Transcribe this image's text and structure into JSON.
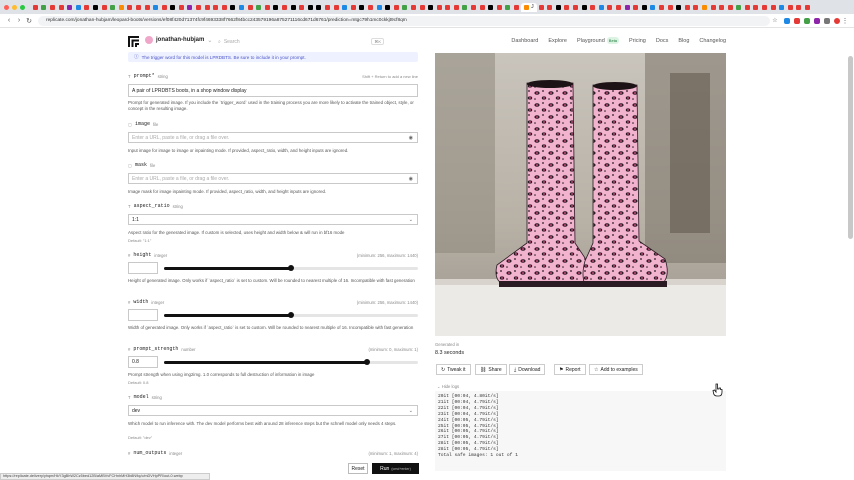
{
  "browser": {
    "url": "replicate.com/jonathan-hubjam/leopard-boots/versions/ef08f420d71374fc9f4693338f7662f84bcc243579196a875271116cd671d6761/prediction=mtgc79h1mc0ckkjt9cf8qm",
    "tab_colors": [
      "#e53935",
      "#43a047",
      "#e53935",
      "#e53935",
      "#8e24aa",
      "#1e88e5",
      "#e53935",
      "#000000",
      "#e53935",
      "#43a047",
      "#fb8c00",
      "#e53935",
      "#e53935",
      "#e53935",
      "#1e88e5",
      "#e53935",
      "#000000",
      "#e53935",
      "#8e24aa",
      "#e53935",
      "#e53935",
      "#e53935",
      "#e53935",
      "#000000",
      "#1e88e5",
      "#e53935",
      "#43a047",
      "#e53935",
      "#000000",
      "#e53935",
      "#000000",
      "#e53935",
      "#000000",
      "#000000",
      "#e53935",
      "#e53935",
      "#1e88e5",
      "#e53935",
      "#000000",
      "#e53935",
      "#1e88e5",
      "#000000",
      "#e53935",
      "#43a047",
      "#e53935",
      "#e53935",
      "#000000",
      "#e53935",
      "#e53935",
      "#e53935",
      "#43a047",
      "#e53935",
      "#e53935",
      "#000000",
      "#e53935",
      "#43a047",
      "#e53935",
      "#fb8c00",
      "#e53935",
      "#e53935",
      "#000000",
      "#e53935",
      "#e53935",
      "#000000",
      "#e53935",
      "#1e88e5",
      "#e53935",
      "#e53935",
      "#8e24aa",
      "#e53935",
      "#000000",
      "#1e88e5",
      "#e53935",
      "#e53935",
      "#000000",
      "#e53935",
      "#e53935",
      "#fb8c00",
      "#e53935",
      "#e53935",
      "#e53935",
      "#43a047",
      "#e53935",
      "#e53935",
      "#e53935",
      "#e53935",
      "#1e88e5",
      "#e53935",
      "#e53935",
      "#e53935"
    ],
    "active_tab_label": "J",
    "status_url": "https://replicate.delivery/yhqm/HkY3gBhW2Cz5bed12B/aMBVvFCHnhMH3b8N9q/c/mDVHpPR/out-0.webp"
  },
  "site": {
    "user": "jonathan-hubjam",
    "search_placeholder": "Search",
    "search_kbd": "⌘K",
    "nav": [
      "Dashboard",
      "Explore",
      "Playground",
      "Pricing",
      "Docs",
      "Blog",
      "Changelog"
    ],
    "playground_badge": "Beta"
  },
  "form": {
    "trigger_note": "The trigger word for this model is LPRDBTS. Be sure to include it in your prompt.",
    "prompt": {
      "name": "prompt*",
      "type": "string",
      "hint": "Shift + Return to add a new line",
      "value": "A pair of LPRDBTS boots, in a shop window display",
      "help": "Prompt for generated image. If you include the `trigger_word` used in the training process you are more likely to activate the trained object, style, or concept in the resulting image."
    },
    "image": {
      "name": "image",
      "type": "file",
      "placeholder": "Enter a URL, paste a file, or drag a file over.",
      "help": "Input image for image to image or inpainting mode. If provided, aspect_ratio, width, and height inputs are ignored."
    },
    "mask": {
      "name": "mask",
      "type": "file",
      "placeholder": "Enter a URL, paste a file, or drag a file over.",
      "help": "Image mask for image inpainting mode. If provided, aspect_ratio, width, and height inputs are ignored."
    },
    "aspect_ratio": {
      "name": "aspect_ratio",
      "type": "string",
      "value": "1:1",
      "help": "Aspect ratio for the generated image. If custom is selected, uses height and width below & will run in bf16 mode",
      "default": "Default: \"1:1\""
    },
    "height": {
      "name": "height",
      "type": "integer",
      "range": "(minimum: 256, maximum: 1440)",
      "value": "",
      "slider": 0.5,
      "help": "Height of generated image. Only works if `aspect_ratio` is set to custom. Will be rounded to nearest multiple of 16. Incompatible with fast generation"
    },
    "width": {
      "name": "width",
      "type": "integer",
      "range": "(minimum: 256, maximum: 1440)",
      "value": "",
      "slider": 0.5,
      "help": "Width of generated image. Only works if `aspect_ratio` is set to custom. Will be rounded to nearest multiple of 16. Incompatible with fast generation"
    },
    "prompt_strength": {
      "name": "prompt_strength",
      "type": "number",
      "range": "(minimum: 0, maximum: 1)",
      "value": "0.8",
      "slider": 0.8,
      "help": "Prompt strength when using img2img. 1.0 corresponds to full destruction of information in image",
      "default": "Default: 0.8"
    },
    "model": {
      "name": "model",
      "type": "string",
      "value": "dev",
      "help": "Which model to run inference with. The dev model performs best with around 28 inference steps but the schnell model only needs 4 steps.",
      "default": "Default: \"dev\""
    },
    "num_outputs": {
      "name": "num_outputs",
      "type": "integer",
      "range": "(minimum: 1, maximum: 4)"
    },
    "reset_label": "Reset",
    "run_label": "Run",
    "run_kbd": "(cmd+enter)"
  },
  "output": {
    "generated_in_label": "Generated in",
    "generated_time": "8.3 seconds",
    "buttons": [
      "Tweak it",
      "Share",
      "Download",
      "Report",
      "Add to examples"
    ],
    "hide_logs": "Hide logs",
    "logs": [
      "20it [00:04,  4.80it/s]",
      "21it [00:04,  4.79it/s]",
      "22it [00:04,  4.79it/s]",
      "23it [00:04,  4.79it/s]",
      "24it [00:05,  4.79it/s]",
      "25it [00:05,  4.79it/s]",
      "26it [00:05,  4.79it/s]",
      "27it [00:05,  4.79it/s]",
      "28it [00:05,  4.79it/s]",
      "28it [00:05,  4.79it/s]",
      "Total safe images: 1 out of 1"
    ]
  }
}
